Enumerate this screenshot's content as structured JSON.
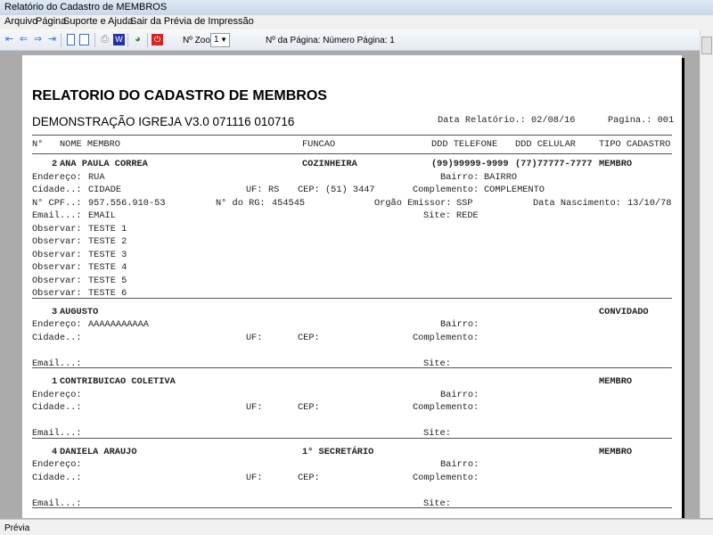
{
  "window": {
    "title": "Relatório do Cadastro de MEMBROS"
  },
  "menu": [
    "Arquivo",
    "Página",
    "Suporte e Ajuda",
    "Sair da Prévia de Impressão"
  ],
  "toolbar": {
    "zoom_label": "Nº Zoom",
    "zoom_value": "1",
    "page_label": "Nº da Página: Número Página: 1"
  },
  "status": "Prévia",
  "report": {
    "title": "RELATORIO DO CADASTRO DE MEMBROS",
    "subtitle": "DEMONSTRAÇÃO IGREJA V3.0 071116 010716",
    "date": "Data Relatório.: 02/08/16",
    "page": "Pagina.: 001",
    "columns": [
      "N°",
      "NOME MEMBRO",
      "FUNCAO",
      "DDD TELEFONE",
      "DDD CELULAR",
      "TIPO CADASTRO"
    ],
    "labels": {
      "endereco": "Endereço:",
      "bairro": "Bairro:",
      "cidade": "Cidade..:",
      "uf": "UF:",
      "cep": "CEP:",
      "complemento": "Complemento:",
      "cpf": "N° CPF..:",
      "rg": "N° do RG:",
      "orgao": "Orgão Emissor:",
      "nasc": "Data Nascimento:",
      "email": "Email...:",
      "site": "Site:",
      "observar": "Observar:"
    },
    "records": [
      {
        "num": "2",
        "name": "ANA PAULA CORREA",
        "funcao": "COZINHEIRA",
        "telefone": "(99)99999-9999",
        "celular": "(77)77777-7777",
        "tipo": "MEMBRO",
        "endereco": "RUA",
        "bairro": "BAIRRO",
        "cidade": "CIDADE",
        "uf": "RS",
        "cep": "(51) 3447",
        "complemento": "COMPLEMENTO",
        "cpf": "957.556.910-53",
        "rg": "454545",
        "orgao": "SSP",
        "nasc": "13/10/78",
        "email": "EMAIL",
        "site": "REDE",
        "obs": [
          "TESTE 1",
          "TESTE 2",
          "TESTE 3",
          "TESTE 4",
          "TESTE 5",
          "TESTE 6"
        ]
      },
      {
        "num": "3",
        "name": "AUGUSTO",
        "funcao": "",
        "telefone": "",
        "celular": "",
        "tipo": "CONVIDADO",
        "endereco": "AAAAAAAAAAA",
        "bairro": "",
        "cidade": "",
        "uf": "",
        "cep": "",
        "complemento": "",
        "email": "",
        "site": "",
        "obs": []
      },
      {
        "num": "1",
        "name": "CONTRIBUICAO COLETIVA",
        "funcao": "",
        "telefone": "",
        "celular": "",
        "tipo": "MEMBRO",
        "endereco": "",
        "bairro": "",
        "cidade": "",
        "uf": "",
        "cep": "",
        "complemento": "",
        "email": "",
        "site": "",
        "obs": []
      },
      {
        "num": "4",
        "name": "DANIELA ARAUJO",
        "funcao": "1° SECRETÁRIO",
        "telefone": "",
        "celular": "",
        "tipo": "MEMBRO",
        "endereco": "",
        "bairro": "",
        "cidade": "",
        "uf": "",
        "cep": "",
        "complemento": "",
        "email": "",
        "site": "",
        "obs": []
      }
    ]
  }
}
